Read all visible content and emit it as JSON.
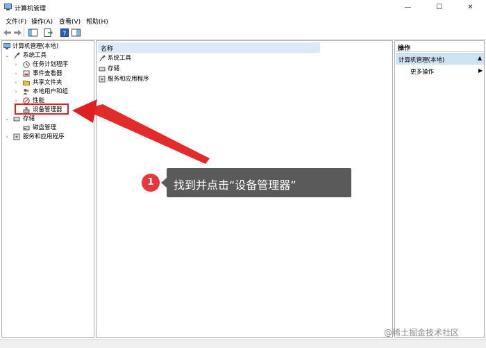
{
  "window": {
    "title": "计算机管理",
    "controls": [
      "—",
      "☐",
      "✕"
    ]
  },
  "menu": [
    {
      "label": "文件(F)"
    },
    {
      "label": "操作(A)"
    },
    {
      "label": "查看(V)"
    },
    {
      "label": "帮助(H)"
    }
  ],
  "toolbar": {
    "buttons": [
      "back-arrow",
      "forward-arrow",
      "show-hide-console-tree",
      "export-list",
      "help",
      "show-hide-action-pane"
    ]
  },
  "tree": {
    "root": "计算机管理(本地)",
    "system_tools": "系统工具",
    "task_scheduler": "任务计划程序",
    "event_viewer": "事件查看器",
    "shared_folders": "共享文件夹",
    "local_users": "本地用户和组",
    "performance": "性能",
    "device_manager": "设备管理器",
    "storage": "存储",
    "disk_management": "磁盘管理",
    "services_apps": "服务和应用程序"
  },
  "list": {
    "column_name": "名称",
    "items": [
      "系统工具",
      "存储",
      "服务和应用程序"
    ]
  },
  "actions": {
    "title": "操作",
    "section": "计算机管理(本地)",
    "more": "更多操作"
  },
  "annotation": {
    "step": "1",
    "text": "找到并点击“设备管理器”",
    "color": "#e02020"
  },
  "watermark": "@稀土掘金技术社区"
}
